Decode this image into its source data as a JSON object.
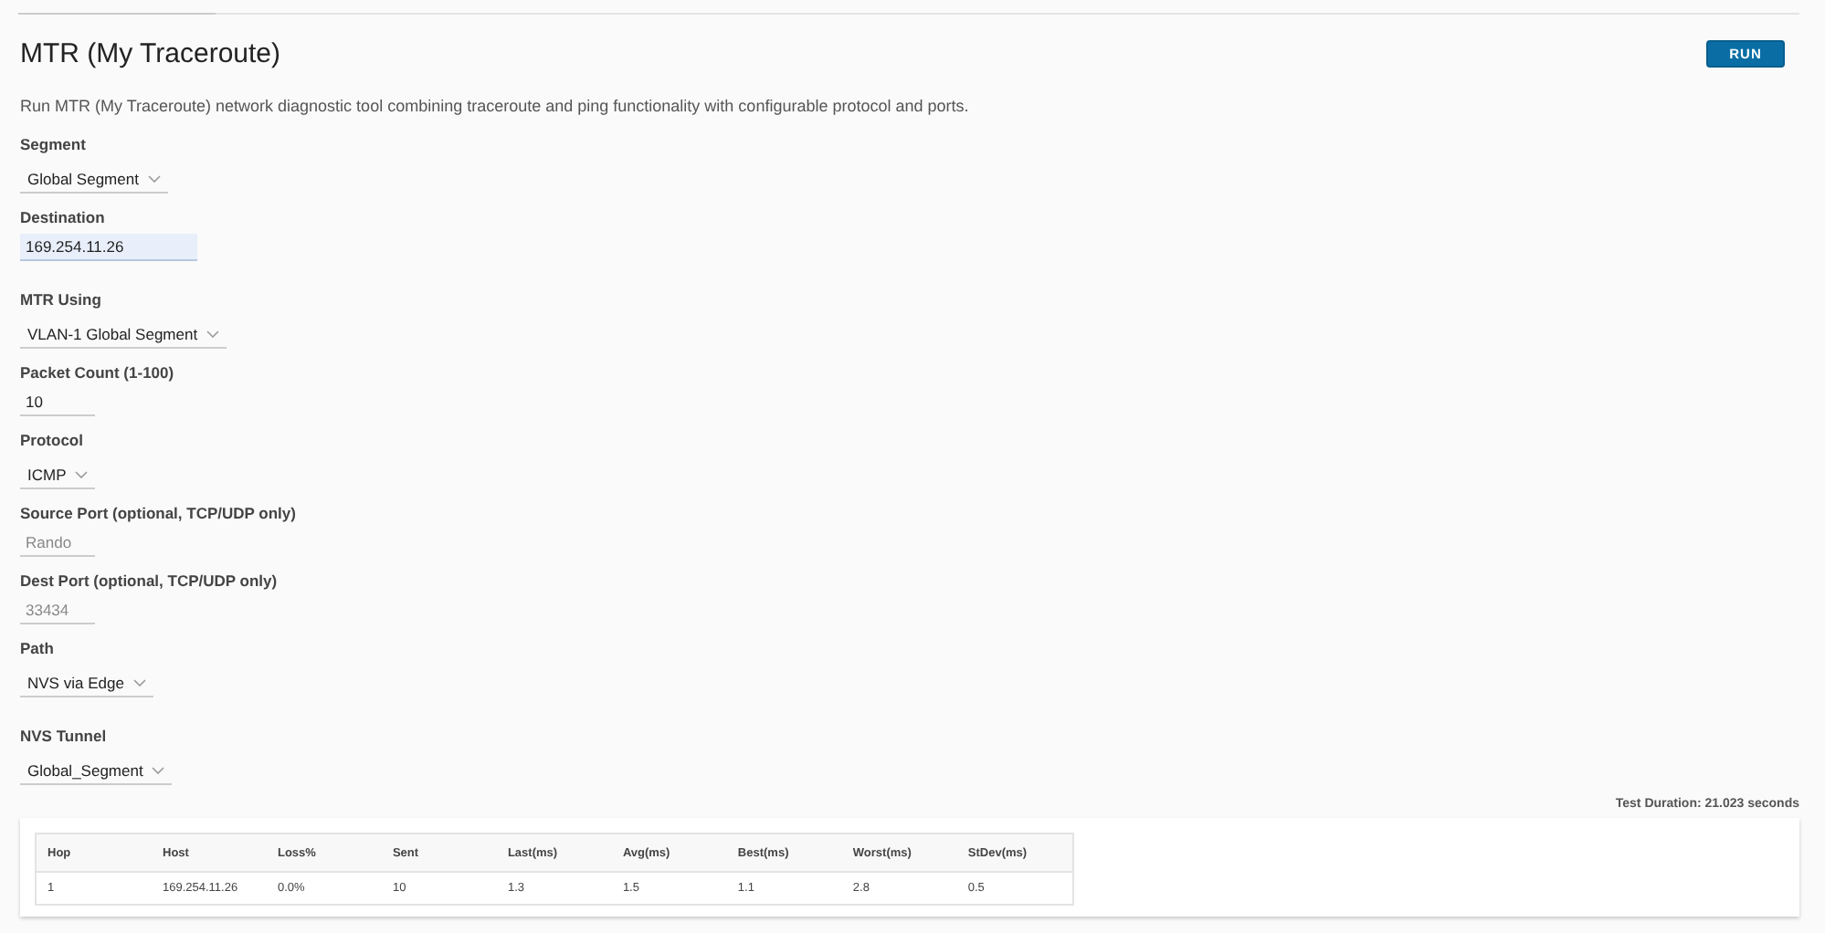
{
  "header": {
    "title": "MTR (My Traceroute)",
    "run_button": "RUN",
    "description": "Run MTR (My Traceroute) network diagnostic tool combining traceroute and ping functionality with configurable protocol and ports."
  },
  "field_groups": [
    [
      {
        "kind": "select",
        "label": "Segment",
        "value": "Global Segment",
        "focused": false
      },
      {
        "kind": "input",
        "label": "Destination",
        "value": "169.254.11.26",
        "focused": true
      }
    ],
    [
      {
        "kind": "select",
        "label": "MTR Using",
        "value": "VLAN-1 Global Segment",
        "focused": false
      },
      {
        "kind": "input",
        "label": "Packet Count (1-100)",
        "value": "10",
        "focused": false
      },
      {
        "kind": "select",
        "label": "Protocol",
        "value": "ICMP",
        "focused": false
      },
      {
        "kind": "input",
        "label": "Source Port (optional, TCP/UDP only)",
        "placeholder": "Rando",
        "focused": false
      },
      {
        "kind": "input",
        "label": "Dest Port (optional, TCP/UDP only)",
        "placeholder": "33434",
        "focused": false
      },
      {
        "kind": "select",
        "label": "Path",
        "value": "NVS via Edge",
        "focused": false
      }
    ],
    [
      {
        "kind": "select",
        "label": "NVS Tunnel",
        "value": "Global_Segment",
        "focused": false
      }
    ]
  ],
  "test_duration": "Test Duration: 21.023 seconds",
  "table": {
    "columns": [
      "Hop",
      "Host",
      "Loss%",
      "Sent",
      "Last(ms)",
      "Avg(ms)",
      "Best(ms)",
      "Worst(ms)",
      "StDev(ms)"
    ],
    "rows": [
      [
        "1",
        "169.254.11.26",
        "0.0%",
        "10",
        "1.3",
        "1.5",
        "1.1",
        "2.8",
        "0.5"
      ]
    ]
  }
}
